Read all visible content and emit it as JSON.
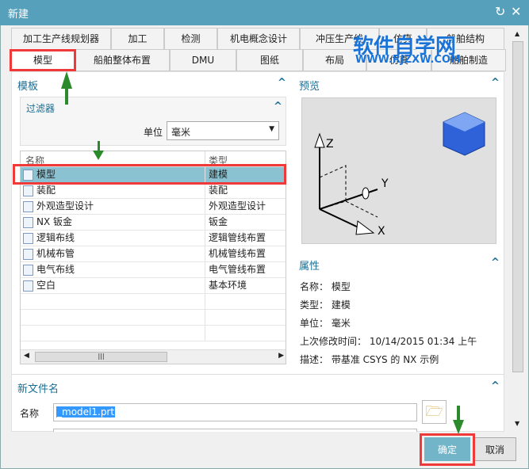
{
  "window": {
    "title": "新建",
    "refresh_icon": "refresh-icon",
    "close_icon": "close-icon"
  },
  "tabs_row1": [
    "加工生产线规划器",
    "加工",
    "检测",
    "机电概念设计",
    "冲压生产线",
    "仿真",
    "船舶结构"
  ],
  "tabs_row2": [
    "模型",
    "船舶整体布置",
    "DMU",
    "图纸",
    "布局",
    "仿真",
    "船舶制造"
  ],
  "watermark": {
    "title": "软件自学网",
    "url": "WWW.RJZXW.COM"
  },
  "template": {
    "header": "模板",
    "filter": {
      "header": "过滤器",
      "unit_label": "单位",
      "unit_value": "毫米"
    },
    "columns": [
      "名称",
      "类型"
    ],
    "rows": [
      {
        "name": "模型",
        "type": "建模",
        "selected": true
      },
      {
        "name": "装配",
        "type": "装配"
      },
      {
        "name": "外观造型设计",
        "type": "外观造型设计"
      },
      {
        "name": "NX 钣金",
        "type": "钣金"
      },
      {
        "name": "逻辑布线",
        "type": "逻辑管线布置"
      },
      {
        "name": "机械布管",
        "type": "机械管线布置"
      },
      {
        "name": "电气布线",
        "type": "电气管线布置"
      },
      {
        "name": "空白",
        "type": "基本环境"
      }
    ]
  },
  "preview": {
    "header": "预览",
    "axes": [
      "Z",
      "Y",
      "X"
    ]
  },
  "properties": {
    "header": "属性",
    "lines": [
      "名称： 模型",
      "类型： 建模",
      "单位： 毫米",
      "上次修改时间： 10/14/2015 01:34 上午",
      "描述： 带基准 CSYS 的 NX 示例"
    ]
  },
  "new_file": {
    "header": "新文件名",
    "name_label": "名称",
    "name_value": "_model1.prt"
  },
  "buttons": {
    "ok": "确定",
    "cancel": "取消"
  },
  "colors": {
    "titlebar": "#57a0bb",
    "accent": "#1a6e94",
    "selection": "#8ac2d2",
    "highlight": "#f03a3a"
  }
}
